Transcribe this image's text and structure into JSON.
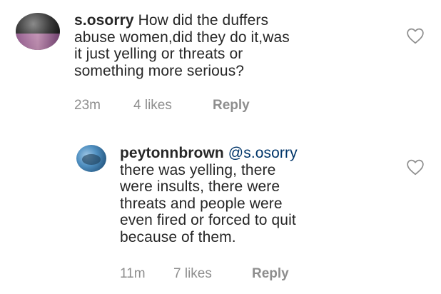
{
  "comments": [
    {
      "username": "s.osorry",
      "text": "How did the duffers abuse women,did they do it,was it just yelling or threats or something more serious?",
      "lines": [
        "How did the duffers",
        "abuse women,did they do it,was",
        "it just yelling or threats or",
        "something more serious?"
      ],
      "time": "23m",
      "likes": "4 likes",
      "reply_label": "Reply",
      "like_icon": "heart-outline-icon"
    },
    {
      "username": "peytonnbrown",
      "mention": "@s.osorry",
      "text": "there was yelling, there were insults, there were threats and people were even fired or forced to quit because of them.",
      "lines": [
        "there was yelling, there",
        "were insults, there were",
        "threats and people were",
        "even fired or forced to quit",
        "because of them."
      ],
      "time": "11m",
      "likes": "7 likes",
      "reply_label": "Reply",
      "like_icon": "heart-outline-icon"
    }
  ]
}
